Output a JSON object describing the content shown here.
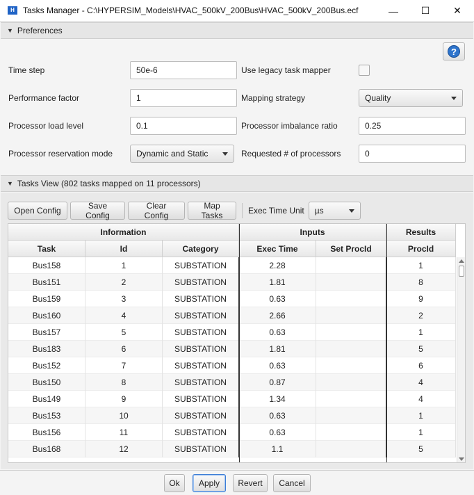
{
  "window": {
    "title": "Tasks Manager - C:\\HYPERSIM_Models\\HVAC_500kV_200Bus\\HVAC_500kV_200Bus.ecf",
    "app_icon_glyph": "H",
    "controls": {
      "minimize": "—",
      "maximize": "☐",
      "close": "✕"
    }
  },
  "preferences": {
    "header": "Preferences",
    "help_glyph": "?",
    "fields": {
      "time_step": {
        "label": "Time step",
        "value": "50e-6"
      },
      "performance_factor": {
        "label": "Performance factor",
        "value": "1"
      },
      "processor_load_level": {
        "label": "Processor load level",
        "value": "0.1"
      },
      "processor_reservation_mode": {
        "label": "Processor reservation mode",
        "value": "Dynamic and Static"
      },
      "use_legacy_task_mapper": {
        "label": "Use legacy task mapper",
        "checked": false
      },
      "mapping_strategy": {
        "label": "Mapping strategy",
        "value": "Quality"
      },
      "processor_imbalance_ratio": {
        "label": "Processor imbalance ratio",
        "value": "0.25"
      },
      "requested_processors": {
        "label": "Requested # of processors",
        "value": "0"
      }
    }
  },
  "tasks_view": {
    "header": "Tasks View (802 tasks mapped on 11 processors)",
    "toolbar": {
      "open_config": "Open Config",
      "save_config": "Save Config",
      "clear_config": "Clear Config",
      "map_tasks": "Map Tasks",
      "exec_time_unit_label": "Exec Time Unit",
      "exec_time_unit_value": "µs"
    },
    "column_groups": [
      "Information",
      "Inputs",
      "Results"
    ],
    "columns": [
      "Task",
      "Id",
      "Category",
      "Exec Time",
      "Set ProcId",
      "ProcId"
    ],
    "rows": [
      [
        "Bus158",
        "1",
        "SUBSTATION",
        "2.28",
        "",
        "1"
      ],
      [
        "Bus151",
        "2",
        "SUBSTATION",
        "1.81",
        "",
        "8"
      ],
      [
        "Bus159",
        "3",
        "SUBSTATION",
        "0.63",
        "",
        "9"
      ],
      [
        "Bus160",
        "4",
        "SUBSTATION",
        "2.66",
        "",
        "2"
      ],
      [
        "Bus157",
        "5",
        "SUBSTATION",
        "0.63",
        "",
        "1"
      ],
      [
        "Bus183",
        "6",
        "SUBSTATION",
        "1.81",
        "",
        "5"
      ],
      [
        "Bus152",
        "7",
        "SUBSTATION",
        "0.63",
        "",
        "6"
      ],
      [
        "Bus150",
        "8",
        "SUBSTATION",
        "0.87",
        "",
        "4"
      ],
      [
        "Bus149",
        "9",
        "SUBSTATION",
        "1.34",
        "",
        "4"
      ],
      [
        "Bus153",
        "10",
        "SUBSTATION",
        "0.63",
        "",
        "1"
      ],
      [
        "Bus156",
        "11",
        "SUBSTATION",
        "0.63",
        "",
        "1"
      ],
      [
        "Bus168",
        "12",
        "SUBSTATION",
        "1.1",
        "",
        "5"
      ]
    ]
  },
  "dialog_buttons": {
    "ok": "Ok",
    "apply": "Apply",
    "revert": "Revert",
    "cancel": "Cancel"
  }
}
